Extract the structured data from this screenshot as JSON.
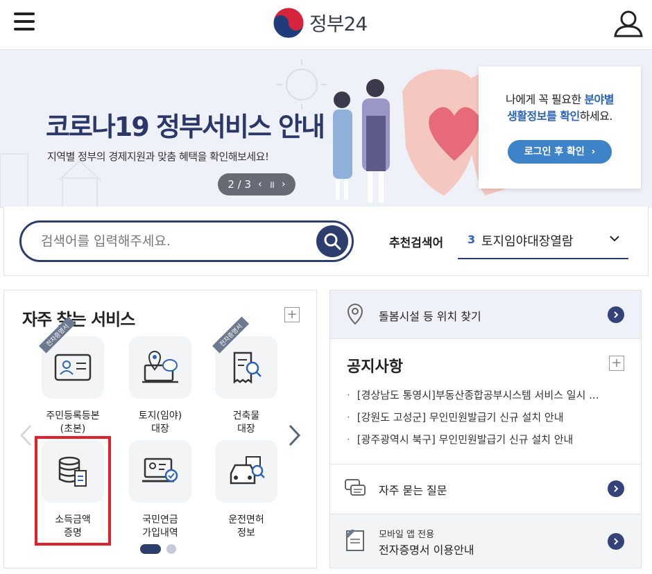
{
  "header": {
    "logo_title": "정부24",
    "menu_icon": "hamburger-menu-icon",
    "user_icon": "user-icon"
  },
  "banner": {
    "title": "코로나19 정부서비스 안내",
    "subtitle": "지역별 정부의 경제지원과 맞춤 혜택을 확인해보세요!",
    "pager": "2 / 3",
    "login_card": {
      "line1_pre": "나에게 꼭 필요한 ",
      "line1_hl": "분야별",
      "line2_hl": "생활정보를 확인",
      "line2_post": "하세요.",
      "button": "로그인 후 확인"
    }
  },
  "search": {
    "placeholder": "검색어를 입력해주세요.",
    "recommended_label": "추천검색어",
    "recommended_rank": "3",
    "recommended_term": "토지임야대장열람"
  },
  "services": {
    "title": "자주 찾는 서비스",
    "ribbon": "전자증명서",
    "items": [
      {
        "line1": "주민등록등본",
        "line2": "(초본)",
        "icon": "id-card-icon",
        "ribbon": true
      },
      {
        "line1": "토지(임야)",
        "line2": "대장",
        "icon": "land-map-icon",
        "ribbon": false
      },
      {
        "line1": "건축물",
        "line2": "대장",
        "icon": "building-document-icon",
        "ribbon": true
      },
      {
        "line1": "소득금액",
        "line2": "증명",
        "icon": "income-coins-icon",
        "ribbon": false
      },
      {
        "line1": "국민연금",
        "line2": "가입내역",
        "icon": "pension-laptop-icon",
        "ribbon": false
      },
      {
        "line1": "운전면허",
        "line2": "정보",
        "icon": "car-license-icon",
        "ribbon": false
      }
    ],
    "active_page": 1,
    "pages": 2
  },
  "right": {
    "care_link": "돌봄시설 등 위치 찾기",
    "notice_title": "공지사항",
    "notices": [
      "[경상남도 통영시]부동산종합공부시스템 서비스 일시 ...",
      "[강원도 고성군] 무인민원발급기 신규 설치 안내",
      "[광주광역시 북구] 무인민원발급기 신규 설치 안내"
    ],
    "faq_link": "자주 묻는 질문",
    "mobile_small": "모바일 앱 전용",
    "mobile_main": "전자증명서 이용안내"
  },
  "colors": {
    "navy": "#2d3d6e",
    "accent_blue": "#2b63b8",
    "highlight_red": "#e0202a"
  }
}
